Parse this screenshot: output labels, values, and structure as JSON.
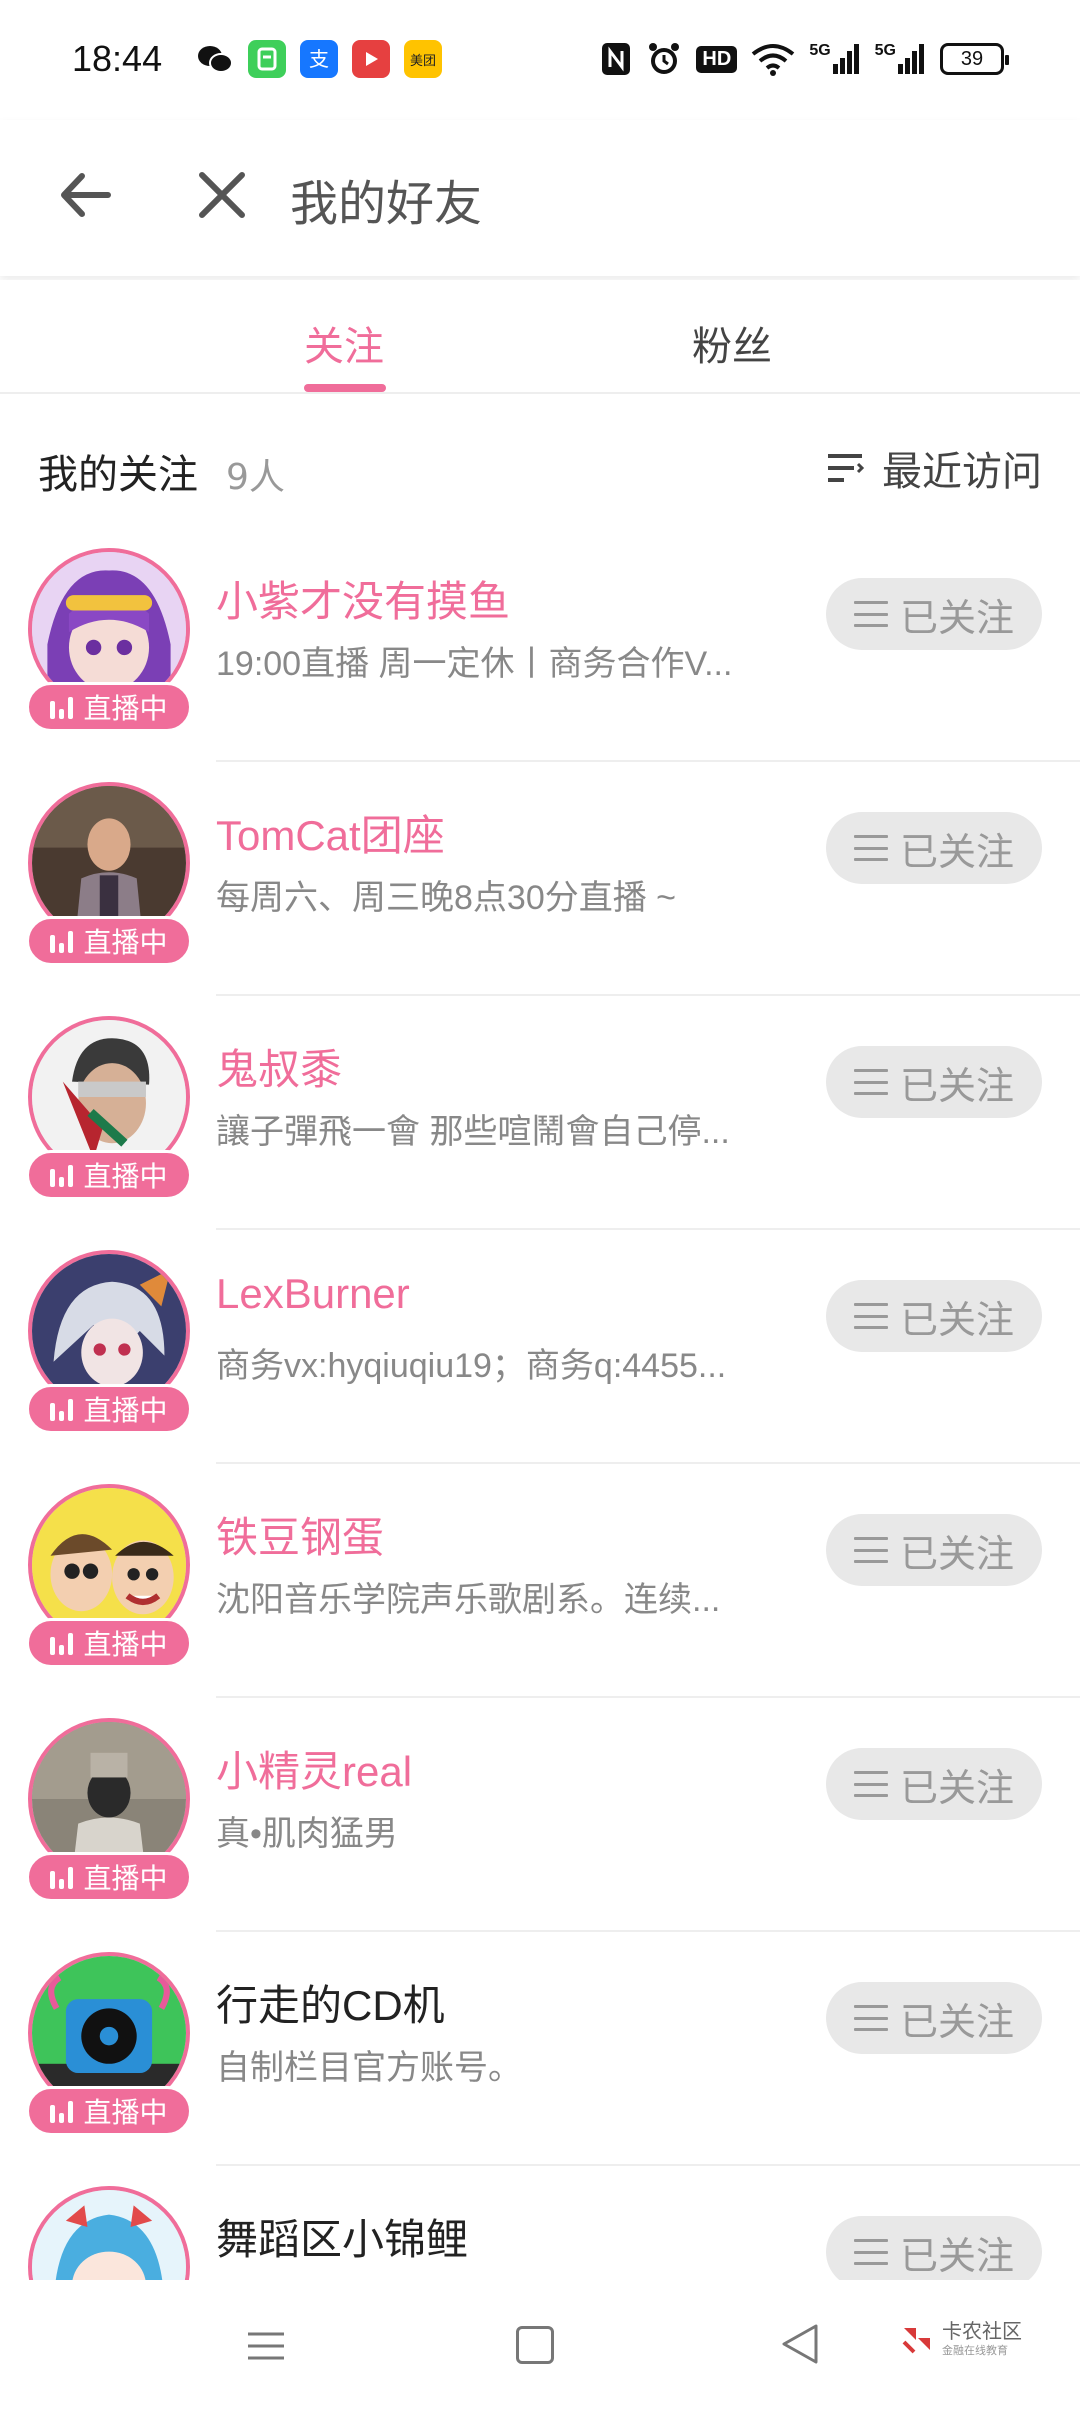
{
  "status_bar": {
    "time": "18:44",
    "battery": "39",
    "icons": [
      "nfc-icon",
      "alarm-icon",
      "hd-icon",
      "wifi-icon",
      "5g-signal-icon",
      "5g-signal-icon",
      "battery-icon"
    ],
    "apps": [
      {
        "icon": "wechat-icon",
        "color": "#ffffff"
      },
      {
        "icon": "green-app-icon",
        "color": "#3ecf5a"
      },
      {
        "icon": "alipay-icon",
        "color": "#1677ff"
      },
      {
        "icon": "video-app-icon",
        "color": "#e64040"
      },
      {
        "icon": "meituan-icon",
        "color": "#ffc300",
        "label": "美团"
      }
    ],
    "hd_label": "HD",
    "signal_label": "5G"
  },
  "header": {
    "title": "我的好友"
  },
  "tabs": [
    {
      "label": "关注",
      "active": true
    },
    {
      "label": "粉丝",
      "active": false
    }
  ],
  "section": {
    "title": "我的关注",
    "count": "9人",
    "sort_label": "最近访问"
  },
  "live_label": "直播中",
  "follow_label": "已关注",
  "accent_color": "#f06d9a",
  "users": [
    {
      "name": "小紫才没有摸鱼",
      "desc": "19:00直播 周一定休丨商务合作V...",
      "live": true,
      "highlight": true
    },
    {
      "name": "TomCat团座",
      "desc": "每周六、周三晚8点30分直播 ~",
      "live": true,
      "highlight": true
    },
    {
      "name": "鬼叔黍",
      "desc": "讓子彈飛一會 那些喧鬧會自己停...",
      "live": true,
      "highlight": true
    },
    {
      "name": "LexBurner",
      "desc": "商务vx:hyqiuqiu19；商务q:4455...",
      "live": true,
      "highlight": true
    },
    {
      "name": "铁豆钢蛋",
      "desc": "沈阳音乐学院声乐歌剧系。连续...",
      "live": true,
      "highlight": true
    },
    {
      "name": "小精灵real",
      "desc": "真•肌肉猛男",
      "live": true,
      "highlight": true
    },
    {
      "name": "行走的CD机",
      "desc": "自制栏目官方账号。",
      "live": true,
      "highlight": false
    },
    {
      "name": "舞蹈区小锦鲤",
      "desc": "",
      "live": false,
      "highlight": false
    }
  ],
  "navbar": {
    "watermark_title": "卡农社区",
    "watermark_sub": "金融在线教育"
  }
}
